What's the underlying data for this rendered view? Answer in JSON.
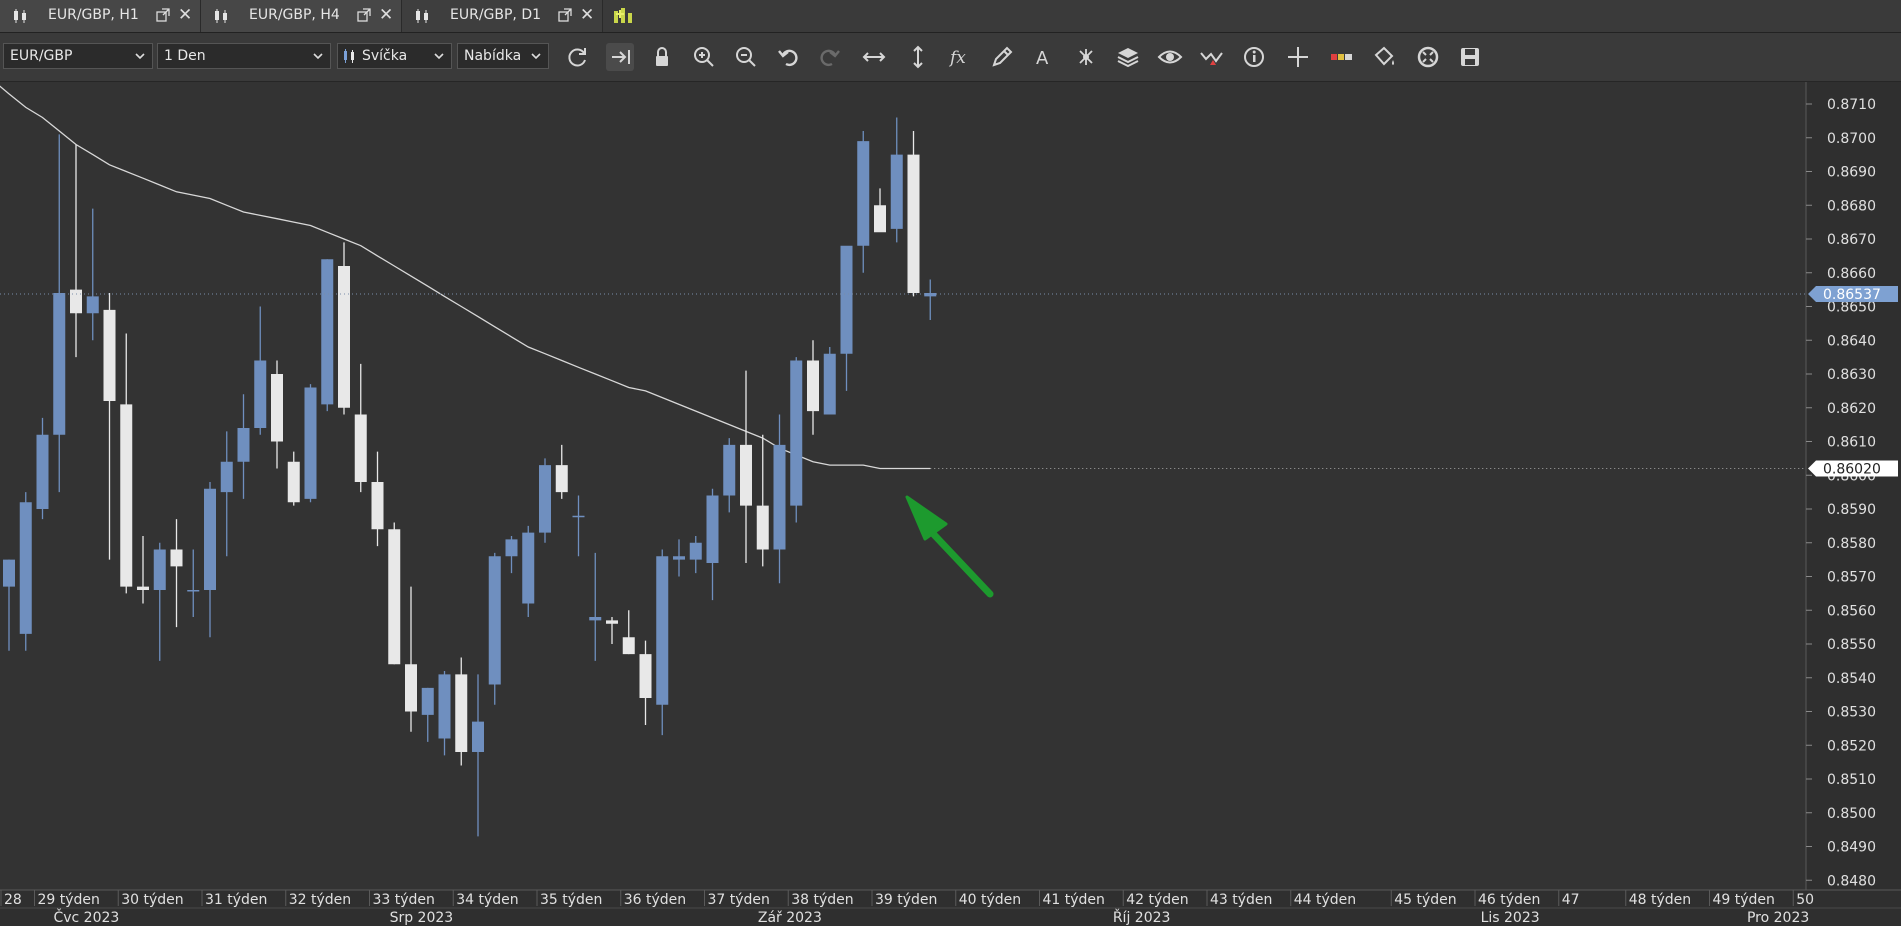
{
  "tabs": [
    {
      "label": "EUR/GBP, H1"
    },
    {
      "label": "EUR/GBP, H4"
    },
    {
      "label": "EUR/GBP, D1",
      "active": true
    }
  ],
  "toolbar": {
    "instrument": "EUR/GBP",
    "period": "1 Den",
    "chart_type": "Svíčka",
    "price_side": "Nabídka",
    "icons": [
      "refresh-icon",
      "shift-right-icon",
      "lock-icon",
      "zoom-in-icon",
      "zoom-out-icon",
      "undo-icon",
      "redo-icon",
      "horizontal-scale-icon",
      "vertical-scale-icon",
      "indicators-fx-icon",
      "pencil-icon",
      "text-icon",
      "pattern-icon",
      "layers-icon",
      "eye-icon",
      "signals-icon",
      "info-icon",
      "crosshair-icon",
      "ruler-icon",
      "paint-bucket-icon",
      "templates-icon",
      "save-icon"
    ]
  },
  "colors": {
    "bg": "#333333",
    "grid": "#3b3b3b",
    "bull": "#6f8fbf",
    "bear": "#e8e8e8",
    "ma": "#d8d8d8",
    "axis_text": "#e0e0e0",
    "arrow": "#1d9a2e"
  },
  "chart_data": {
    "type": "candlestick",
    "instrument": "EUR/GBP",
    "timeframe": "D1",
    "ylim": [
      0.8485,
      0.8714
    ],
    "y_ticks": [
      0.871,
      0.87,
      0.869,
      0.868,
      0.867,
      0.866,
      0.865,
      0.864,
      0.863,
      0.862,
      0.861,
      0.86,
      0.859,
      0.858,
      0.857,
      0.856,
      0.855,
      0.854,
      0.853,
      0.852,
      0.851,
      0.85,
      0.849,
      0.848
    ],
    "y_tick_labels": [
      "0.8710",
      "0.8700",
      "0.8690",
      "0.8680",
      "0.8670",
      "0.8660",
      "0.8650",
      "0.8640",
      "0.8630",
      "0.8620",
      "0.8610",
      "0.8600",
      "0.8590",
      "0.8580",
      "0.8570",
      "0.8560",
      "0.8550",
      "0.8540",
      "0.8530",
      "0.8520",
      "0.8510",
      "0.8500",
      "0.8490",
      "0.8480"
    ],
    "current_price": 0.86537,
    "current_price_label": "0.86537",
    "ma_price": 0.8602,
    "ma_price_label": "0.86020",
    "candles": [
      {
        "o": 0.8567,
        "h": 0.8575,
        "l": 0.8548,
        "c": 0.8575
      },
      {
        "o": 0.8553,
        "h": 0.8595,
        "l": 0.8548,
        "c": 0.8592
      },
      {
        "o": 0.859,
        "h": 0.8617,
        "l": 0.8587,
        "c": 0.8612
      },
      {
        "o": 0.8612,
        "h": 0.8701,
        "l": 0.8595,
        "c": 0.8654
      },
      {
        "o": 0.8655,
        "h": 0.8698,
        "l": 0.8635,
        "c": 0.8648
      },
      {
        "o": 0.8648,
        "h": 0.8679,
        "l": 0.864,
        "c": 0.8653
      },
      {
        "o": 0.8649,
        "h": 0.8654,
        "l": 0.8575,
        "c": 0.8622
      },
      {
        "o": 0.8621,
        "h": 0.8642,
        "l": 0.8565,
        "c": 0.8567
      },
      {
        "o": 0.8567,
        "h": 0.8582,
        "l": 0.8562,
        "c": 0.8566
      },
      {
        "o": 0.8566,
        "h": 0.858,
        "l": 0.8545,
        "c": 0.8578
      },
      {
        "o": 0.8578,
        "h": 0.8587,
        "l": 0.8555,
        "c": 0.8573
      },
      {
        "o": 0.8566,
        "h": 0.8578,
        "l": 0.8558,
        "c": 0.8566
      },
      {
        "o": 0.8566,
        "h": 0.8598,
        "l": 0.8552,
        "c": 0.8596
      },
      {
        "o": 0.8595,
        "h": 0.8613,
        "l": 0.8576,
        "c": 0.8604
      },
      {
        "o": 0.8604,
        "h": 0.8624,
        "l": 0.8593,
        "c": 0.8614
      },
      {
        "o": 0.8614,
        "h": 0.865,
        "l": 0.8612,
        "c": 0.8634
      },
      {
        "o": 0.863,
        "h": 0.8634,
        "l": 0.8602,
        "c": 0.861
      },
      {
        "o": 0.8604,
        "h": 0.8607,
        "l": 0.8591,
        "c": 0.8592
      },
      {
        "o": 0.8593,
        "h": 0.8627,
        "l": 0.8592,
        "c": 0.8626
      },
      {
        "o": 0.8621,
        "h": 0.8664,
        "l": 0.8619,
        "c": 0.8664
      },
      {
        "o": 0.8662,
        "h": 0.8669,
        "l": 0.8618,
        "c": 0.862
      },
      {
        "o": 0.8618,
        "h": 0.8633,
        "l": 0.8595,
        "c": 0.8598
      },
      {
        "o": 0.8598,
        "h": 0.8607,
        "l": 0.8579,
        "c": 0.8584
      },
      {
        "o": 0.8584,
        "h": 0.8586,
        "l": 0.8544,
        "c": 0.8544
      },
      {
        "o": 0.8544,
        "h": 0.8567,
        "l": 0.8524,
        "c": 0.853
      },
      {
        "o": 0.8529,
        "h": 0.8537,
        "l": 0.8521,
        "c": 0.8537
      },
      {
        "o": 0.8522,
        "h": 0.8542,
        "l": 0.8517,
        "c": 0.8541
      },
      {
        "o": 0.8541,
        "h": 0.8546,
        "l": 0.8514,
        "c": 0.8518
      },
      {
        "o": 0.8518,
        "h": 0.8541,
        "l": 0.8493,
        "c": 0.8527
      },
      {
        "o": 0.8538,
        "h": 0.8577,
        "l": 0.8532,
        "c": 0.8576
      },
      {
        "o": 0.8576,
        "h": 0.8582,
        "l": 0.8571,
        "c": 0.8581
      },
      {
        "o": 0.8562,
        "h": 0.8585,
        "l": 0.8558,
        "c": 0.8583
      },
      {
        "o": 0.8583,
        "h": 0.8605,
        "l": 0.858,
        "c": 0.8603
      },
      {
        "o": 0.8603,
        "h": 0.8609,
        "l": 0.8593,
        "c": 0.8595
      },
      {
        "o": 0.8588,
        "h": 0.8594,
        "l": 0.8576,
        "c": 0.8588
      },
      {
        "o": 0.8557,
        "h": 0.8577,
        "l": 0.8545,
        "c": 0.8558
      },
      {
        "o": 0.8557,
        "h": 0.8558,
        "l": 0.855,
        "c": 0.8556
      },
      {
        "o": 0.8552,
        "h": 0.856,
        "l": 0.8547,
        "c": 0.8547
      },
      {
        "o": 0.8547,
        "h": 0.8551,
        "l": 0.8526,
        "c": 0.8534
      },
      {
        "o": 0.8532,
        "h": 0.8578,
        "l": 0.8523,
        "c": 0.8576
      },
      {
        "o": 0.8575,
        "h": 0.8581,
        "l": 0.857,
        "c": 0.8576
      },
      {
        "o": 0.8575,
        "h": 0.8582,
        "l": 0.8571,
        "c": 0.858
      },
      {
        "o": 0.8574,
        "h": 0.8596,
        "l": 0.8563,
        "c": 0.8594
      },
      {
        "o": 0.8594,
        "h": 0.8611,
        "l": 0.8589,
        "c": 0.8609
      },
      {
        "o": 0.8609,
        "h": 0.8631,
        "l": 0.8574,
        "c": 0.8591
      },
      {
        "o": 0.8591,
        "h": 0.8612,
        "l": 0.8573,
        "c": 0.8578
      },
      {
        "o": 0.8578,
        "h": 0.8618,
        "l": 0.8568,
        "c": 0.8609
      },
      {
        "o": 0.8591,
        "h": 0.8635,
        "l": 0.8586,
        "c": 0.8634
      },
      {
        "o": 0.8634,
        "h": 0.864,
        "l": 0.8612,
        "c": 0.8619
      },
      {
        "o": 0.8618,
        "h": 0.8638,
        "l": 0.8619,
        "c": 0.8636
      },
      {
        "o": 0.8636,
        "h": 0.8666,
        "l": 0.8625,
        "c": 0.8668
      },
      {
        "o": 0.8668,
        "h": 0.8702,
        "l": 0.866,
        "c": 0.8699
      },
      {
        "o": 0.868,
        "h": 0.8685,
        "l": 0.8673,
        "c": 0.8672
      },
      {
        "o": 0.8673,
        "h": 0.8706,
        "l": 0.8669,
        "c": 0.8695
      },
      {
        "o": 0.8695,
        "h": 0.8702,
        "l": 0.8653,
        "c": 0.8654
      },
      {
        "o": 0.8653,
        "h": 0.8658,
        "l": 0.8646,
        "c": 0.8654
      }
    ],
    "ma": [
      0.8713,
      0.8709,
      0.8706,
      0.8702,
      0.8698,
      0.8695,
      0.8692,
      0.869,
      0.8688,
      0.8686,
      0.8684,
      0.8683,
      0.8682,
      0.868,
      0.8678,
      0.8677,
      0.8676,
      0.8675,
      0.8674,
      0.8672,
      0.867,
      0.8668,
      0.8665,
      0.8662,
      0.8659,
      0.8656,
      0.8653,
      0.865,
      0.8647,
      0.8644,
      0.8641,
      0.8638,
      0.8636,
      0.8634,
      0.8632,
      0.863,
      0.8628,
      0.8626,
      0.8625,
      0.8623,
      0.8621,
      0.8619,
      0.8617,
      0.8615,
      0.8613,
      0.8611,
      0.8608,
      0.8606,
      0.8604,
      0.8603,
      0.8603,
      0.8603,
      0.8602,
      0.8602,
      0.8602,
      0.8602
    ],
    "x_labels": [
      {
        "text": "28",
        "i": 0
      },
      {
        "text": "29 týden",
        "i": 2
      },
      {
        "text": "30 týden",
        "i": 7
      },
      {
        "text": "31 týden",
        "i": 12
      },
      {
        "text": "32 týden",
        "i": 17
      },
      {
        "text": "33 týden",
        "i": 22
      },
      {
        "text": "34 týden",
        "i": 27
      },
      {
        "text": "35 týden",
        "i": 32
      },
      {
        "text": "36 týden",
        "i": 37
      },
      {
        "text": "37 týden",
        "i": 42
      },
      {
        "text": "38 týden",
        "i": 47
      },
      {
        "text": "39 týden",
        "i": 52
      },
      {
        "text": "40 týden",
        "i": 57
      },
      {
        "text": "41 týden",
        "i": 62
      },
      {
        "text": "42 týden",
        "i": 67
      },
      {
        "text": "43 týden",
        "i": 72
      },
      {
        "text": "44 týden",
        "i": 77
      },
      {
        "text": "45 týden",
        "i": 83
      },
      {
        "text": "46 týden",
        "i": 88
      },
      {
        "text": "47",
        "i": 93
      },
      {
        "text": "48 týden",
        "i": 97
      },
      {
        "text": "49 týden",
        "i": 102
      },
      {
        "text": "50",
        "i": 107
      }
    ],
    "month_labels": [
      {
        "text": "Čvc 2023",
        "i": 4.5
      },
      {
        "text": "Srp 2023",
        "i": 24.5
      },
      {
        "text": "Zář 2023",
        "i": 46.5
      },
      {
        "text": "Říj 2023",
        "i": 67.5
      },
      {
        "text": "Lis 2023",
        "i": 89.5
      },
      {
        "text": "Pro 2023",
        "i": 105.5
      }
    ]
  }
}
